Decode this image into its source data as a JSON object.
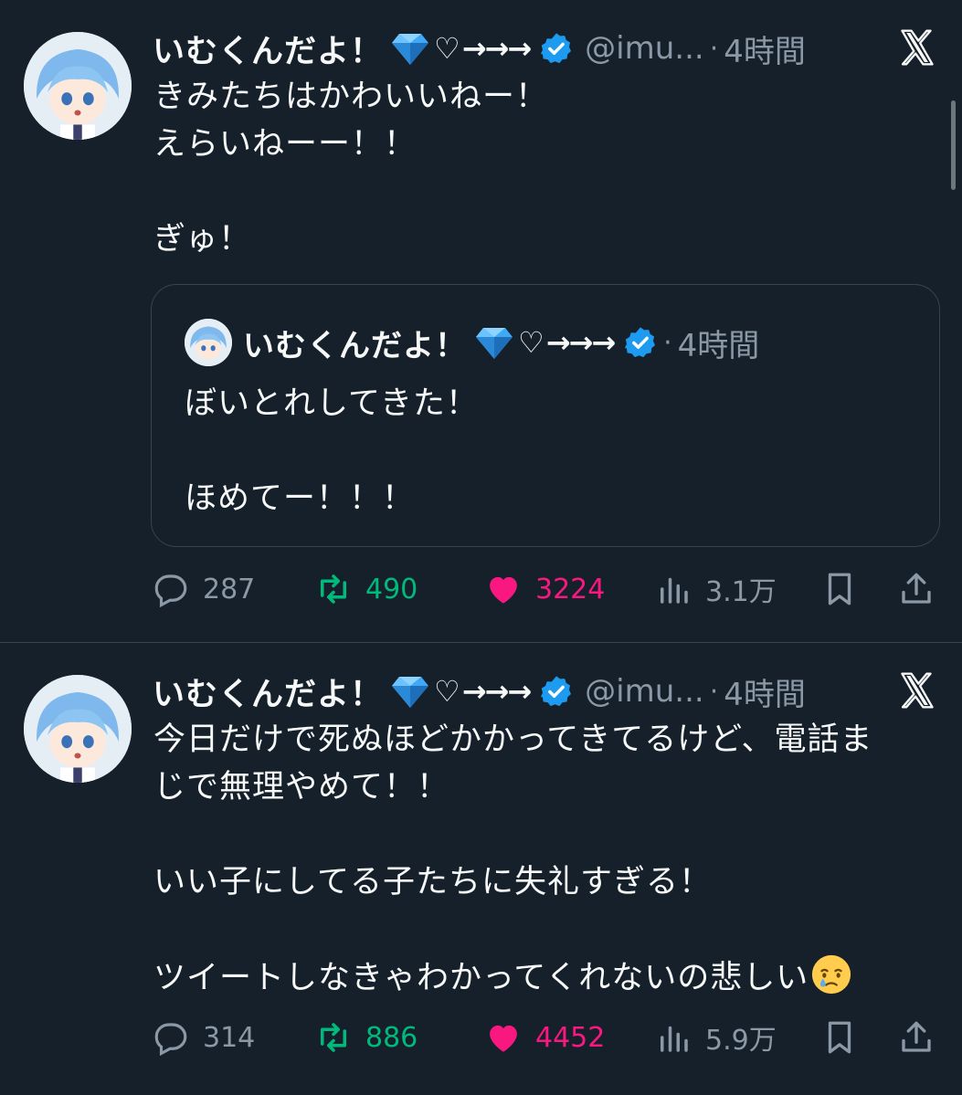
{
  "colors": {
    "background": "#15202b",
    "text": "#f7f9f9",
    "muted": "#8b98a5",
    "verified": "#1d9bf0",
    "retweet": "#00ba7c",
    "like": "#f91880",
    "divider": "#38444d"
  },
  "icons": {
    "verified": "verified-badge-icon",
    "gem": "gem-stone-icon",
    "heart_outline": "heart-outline-icon",
    "platform": "x-logo-icon",
    "reply": "reply-icon",
    "retweet": "retweet-icon",
    "like": "heart-filled-icon",
    "views": "views-chart-icon",
    "bookmark": "bookmark-icon",
    "share": "share-icon",
    "crying_emoji": "crying-face-emoji"
  },
  "tweets": [
    {
      "display_name": "いむくんだよ！",
      "deco_heart": "♡",
      "deco_arrows": "→→→",
      "handle": "@imu...",
      "separator": "·",
      "time": "4時間",
      "lines": [
        "きみたちはかわいいねー！",
        "えらいねーー！！",
        "",
        "ぎゅ！"
      ],
      "quote": {
        "display_name": "いむくんだよ！",
        "deco_heart": "♡",
        "deco_arrows": "→→→",
        "separator": "·",
        "time": "4時間",
        "lines": [
          "ぼいとれしてきた！",
          "",
          "ほめてー！！！"
        ]
      },
      "stats": {
        "replies": "287",
        "retweets": "490",
        "likes": "3224",
        "views": "3.1万"
      }
    },
    {
      "display_name": "いむくんだよ！",
      "deco_heart": "♡",
      "deco_arrows": "→→→",
      "handle": "@imu...",
      "separator": "·",
      "time": "4時間",
      "lines": [
        "今日だけで死ぬほどかかってきてるけど、電話ま",
        "じで無理やめて！！",
        "",
        "いい子にしてる子たちに失礼すぎる！",
        "",
        "ツイートしなきゃわかってくれないの悲しい"
      ],
      "stats": {
        "replies": "314",
        "retweets": "886",
        "likes": "4452",
        "views": "5.9万"
      }
    }
  ]
}
